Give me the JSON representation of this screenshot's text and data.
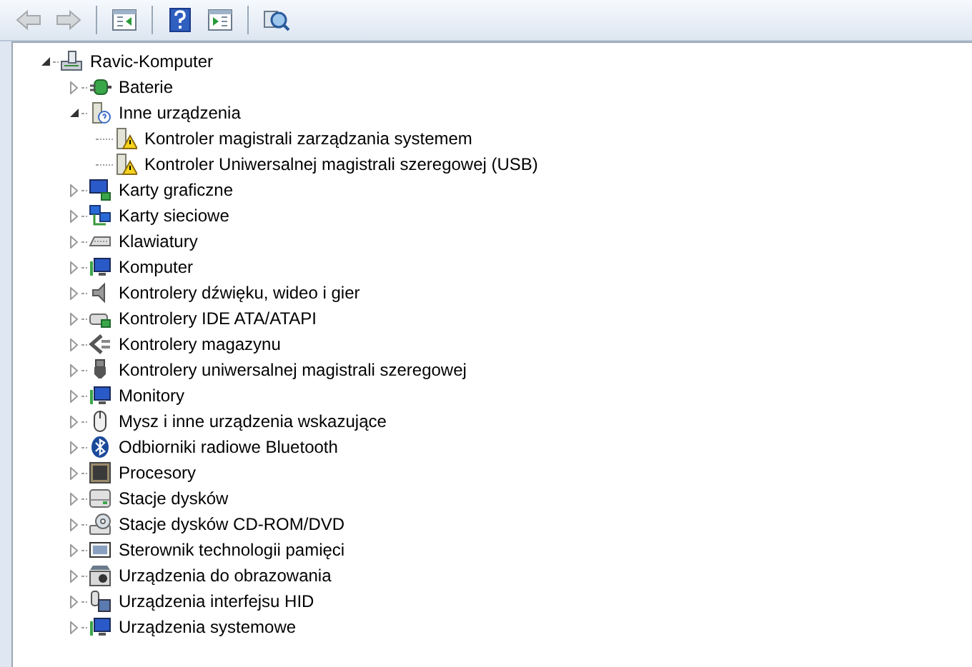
{
  "toolbar": [
    {
      "kind": "back",
      "disabled": true
    },
    {
      "kind": "forward",
      "disabled": true
    },
    {
      "kind": "separator"
    },
    {
      "kind": "console-tree",
      "disabled": false
    },
    {
      "kind": "separator"
    },
    {
      "kind": "help",
      "disabled": false
    },
    {
      "kind": "action-pane",
      "disabled": false
    },
    {
      "kind": "separator"
    },
    {
      "kind": "scan",
      "disabled": false
    }
  ],
  "tree": {
    "label": "Ravic-Komputer",
    "kind": "computer",
    "expanded": true,
    "children": [
      {
        "label": "Baterie",
        "kind": "battery",
        "expanded": false
      },
      {
        "label": "Inne urządzenia",
        "kind": "unknown",
        "expanded": true,
        "children": [
          {
            "label": "Kontroler magistrali zarządzania systemem",
            "kind": "warning"
          },
          {
            "label": "Kontroler Uniwersalnej magistrali szeregowej (USB)",
            "kind": "warning"
          }
        ]
      },
      {
        "label": "Karty graficzne",
        "kind": "display",
        "expanded": false
      },
      {
        "label": "Karty sieciowe",
        "kind": "network",
        "expanded": false
      },
      {
        "label": "Klawiatury",
        "kind": "keyboard",
        "expanded": false
      },
      {
        "label": "Komputer",
        "kind": "monitor",
        "expanded": false
      },
      {
        "label": "Kontrolery dźwięku, wideo i gier",
        "kind": "speaker",
        "expanded": false
      },
      {
        "label": "Kontrolery IDE ATA/ATAPI",
        "kind": "ide",
        "expanded": false
      },
      {
        "label": "Kontrolery magazynu",
        "kind": "storage",
        "expanded": false
      },
      {
        "label": "Kontrolery uniwersalnej magistrali szeregowej",
        "kind": "usb",
        "expanded": false
      },
      {
        "label": "Monitory",
        "kind": "monitor",
        "expanded": false
      },
      {
        "label": "Mysz i inne urządzenia wskazujące",
        "kind": "mouse",
        "expanded": false
      },
      {
        "label": "Odbiorniki radiowe Bluetooth",
        "kind": "bluetooth",
        "expanded": false
      },
      {
        "label": "Procesory",
        "kind": "chip",
        "expanded": false
      },
      {
        "label": "Stacje dysków",
        "kind": "disk",
        "expanded": false
      },
      {
        "label": "Stacje dysków CD-ROM/DVD",
        "kind": "cdrom",
        "expanded": false
      },
      {
        "label": "Sterownik technologii pamięci",
        "kind": "memory",
        "expanded": false
      },
      {
        "label": "Urządzenia do obrazowania",
        "kind": "camera",
        "expanded": false
      },
      {
        "label": "Urządzenia interfejsu HID",
        "kind": "hid",
        "expanded": false
      },
      {
        "label": "Urządzenia systemowe",
        "kind": "monitor",
        "expanded": false
      }
    ]
  }
}
